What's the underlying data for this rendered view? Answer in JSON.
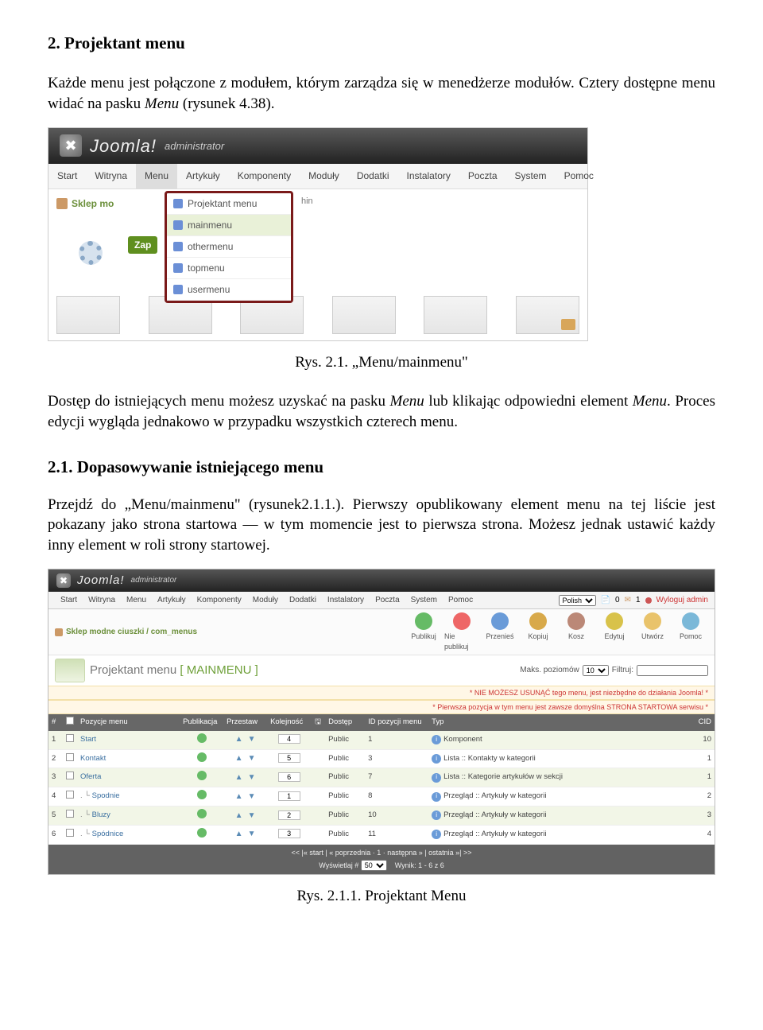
{
  "doc": {
    "h1": "2. Projektant menu",
    "p1_a": "Każde menu jest połączone z modułem, którym zarządza się w menedżerze modułów. Cztery dostępne menu widać na pasku ",
    "p1_em": "Menu",
    "p1_b": " (rysunek 4.38).",
    "fig1_caption": "Rys. 2.1. „Menu/mainmenu\"",
    "p2_a": "Dostęp do istniejących menu możesz uzyskać na pasku ",
    "p2_em1": "Menu",
    "p2_b": " lub klikając odpowiedni element ",
    "p2_em2": "Menu",
    "p2_c": ". Proces edycji wygląda jednakowo w przypadku wszystkich czterech menu.",
    "h2": "2.1. Dopasowywanie istniejącego menu",
    "p3": "Przejdź do „Menu/mainmenu\" (rysunek2.1.1.). Pierwszy opublikowany element menu na tej liście jest pokazany jako strona startowa — w tym momencie jest to pierwsza strona. Możesz jednak ustawić każdy inny element w roli strony startowej.",
    "fig2_caption": "Rys. 2.1.1. Projektant Menu"
  },
  "shot1": {
    "logo": "Joomla!",
    "logo_sub": "administrator",
    "menu": [
      "Start",
      "Witryna",
      "Menu",
      "Artykuły",
      "Komponenty",
      "Moduły",
      "Dodatki",
      "Instalatory",
      "Poczta",
      "System",
      "Pomoc"
    ],
    "crumb": "Sklep mo",
    "hin": "hin",
    "zap": "Zap",
    "dropdown": [
      "Projektant menu",
      "mainmenu",
      "othermenu",
      "topmenu",
      "usermenu"
    ]
  },
  "shot2": {
    "logo": "Joomla!",
    "logo_sub": "administrator",
    "menu": [
      "Start",
      "Witryna",
      "Menu",
      "Artykuły",
      "Komponenty",
      "Moduły",
      "Dodatki",
      "Instalatory",
      "Poczta",
      "System",
      "Pomoc"
    ],
    "lang_label": "Polish",
    "stats": "0",
    "stats2": "1",
    "logout": "Wyloguj admin",
    "crumb": "Sklep modne ciuszki / com_menus",
    "toolbar": [
      {
        "label": "Publikuj"
      },
      {
        "label": "Nie publikuj"
      },
      {
        "label": "Przenieś"
      },
      {
        "label": "Kopiuj"
      },
      {
        "label": "Kosz"
      },
      {
        "label": "Edytuj"
      },
      {
        "label": "Utwórz"
      },
      {
        "label": "Pomoc"
      }
    ],
    "title_a": "Projektant menu ",
    "title_b": "[ MAINMENU ]",
    "levels_label": "Maks. poziomów",
    "levels_val": "10",
    "filter_label": "Filtruj:",
    "warn1": "* NIE MOŻESZ USUNĄĆ tego menu, jest niezbędne do działania Joomla! *",
    "warn2": "* Pierwsza pozycja w tym menu jest zawsze domyślna STRONA STARTOWA serwisu *",
    "headers": [
      "#",
      "",
      "Pozycje menu",
      "Publikacja",
      "Przestaw",
      "Kolejność",
      "",
      "Dostęp",
      "ID pozycji menu",
      "Typ",
      "CID"
    ],
    "rows": [
      {
        "n": "1",
        "name": "Start",
        "indent": "",
        "ord": "4",
        "access": "Public",
        "mid": "1",
        "type": "Komponent",
        "cid": "10"
      },
      {
        "n": "2",
        "name": "Kontakt",
        "indent": "",
        "ord": "5",
        "access": "Public",
        "mid": "3",
        "type": "Lista :: Kontakty w kategorii",
        "cid": "1"
      },
      {
        "n": "3",
        "name": "Oferta",
        "indent": "",
        "ord": "6",
        "access": "Public",
        "mid": "7",
        "type": "Lista :: Kategorie artykułów w sekcji",
        "cid": "1"
      },
      {
        "n": "4",
        "name": "Spodnie",
        "indent": ".  └ ",
        "ord": "1",
        "access": "Public",
        "mid": "8",
        "type": "Przegląd :: Artykuły w kategorii",
        "cid": "2"
      },
      {
        "n": "5",
        "name": "Bluzy",
        "indent": ".  └ ",
        "ord": "2",
        "access": "Public",
        "mid": "10",
        "type": "Przegląd :: Artykuły w kategorii",
        "cid": "3"
      },
      {
        "n": "6",
        "name": "Spódnice",
        "indent": ".  └ ",
        "ord": "3",
        "access": "Public",
        "mid": "11",
        "type": "Przegląd :: Artykuły w kategorii",
        "cid": "4"
      }
    ],
    "save_icon": "🖫",
    "pager1": "<< |« start | « poprzednia · 1 · następna » | ostatnia »| >>",
    "pager2a": "Wyświetlaj #",
    "pager2b": "50",
    "pager2c": "Wynik: 1 - 6 z 6"
  }
}
